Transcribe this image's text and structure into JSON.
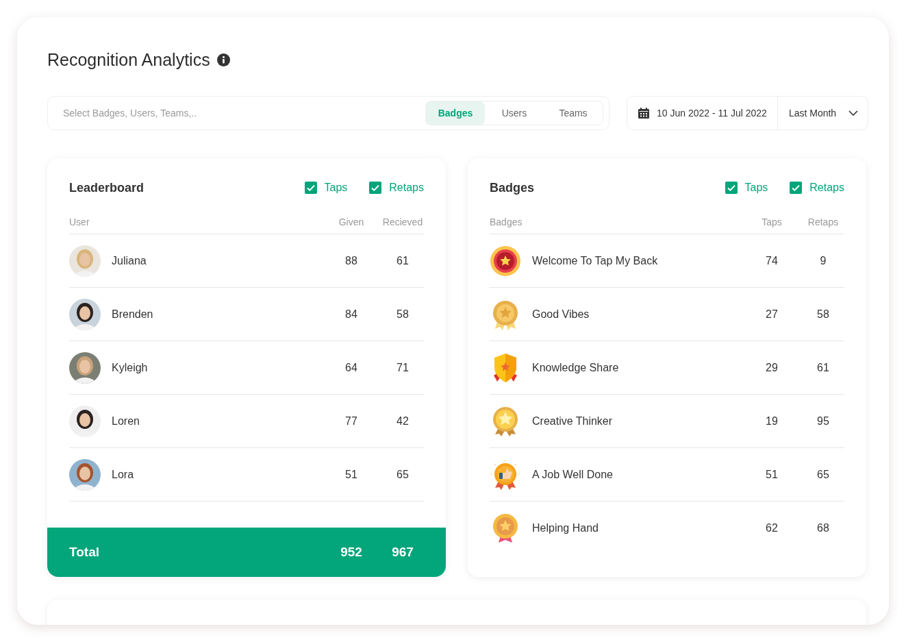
{
  "page": {
    "title": "Recognition Analytics"
  },
  "filter": {
    "placeholder": "Select Badges, Users, Teams,..",
    "tabs": [
      {
        "label": "Badges",
        "selected": true
      },
      {
        "label": "Users",
        "selected": false
      },
      {
        "label": "Teams",
        "selected": false
      }
    ]
  },
  "date_range": {
    "range": "10 Jun 2022 - 11 Jul 2022",
    "preset": "Last Month"
  },
  "leaderboard": {
    "title": "Leaderboard",
    "toggles": [
      {
        "label": "Taps",
        "checked": true
      },
      {
        "label": "Retaps",
        "checked": true
      }
    ],
    "columns": [
      "User",
      "Given",
      "Recieved"
    ],
    "rows": [
      {
        "name": "Juliana",
        "given": "88",
        "received": "61"
      },
      {
        "name": "Brenden",
        "given": "84",
        "received": "58"
      },
      {
        "name": "Kyleigh",
        "given": "64",
        "received": "71"
      },
      {
        "name": "Loren",
        "given": "77",
        "received": "42"
      },
      {
        "name": "Lora",
        "given": "51",
        "received": "65"
      }
    ],
    "total": {
      "label": "Total",
      "given": "952",
      "received": "967"
    }
  },
  "badges": {
    "title": "Badges",
    "toggles": [
      {
        "label": "Taps",
        "checked": true
      },
      {
        "label": "Retaps",
        "checked": true
      }
    ],
    "columns": [
      "Badges",
      "Taps",
      "Retaps"
    ],
    "rows": [
      {
        "kind": "rosette",
        "name": "Welcome To Tap My Back",
        "taps": "74",
        "retaps": "9"
      },
      {
        "kind": "medal",
        "name": "Good Vibes",
        "taps": "27",
        "retaps": "58"
      },
      {
        "kind": "shield",
        "name": "Knowledge Share",
        "taps": "29",
        "retaps": "61"
      },
      {
        "kind": "star",
        "name": "Creative Thinker",
        "taps": "19",
        "retaps": "95"
      },
      {
        "kind": "thumbs",
        "name": "A Job Well Done",
        "taps": "51",
        "retaps": "65"
      },
      {
        "kind": "bow",
        "name": "Helping Hand",
        "taps": "62",
        "retaps": "68"
      }
    ]
  }
}
